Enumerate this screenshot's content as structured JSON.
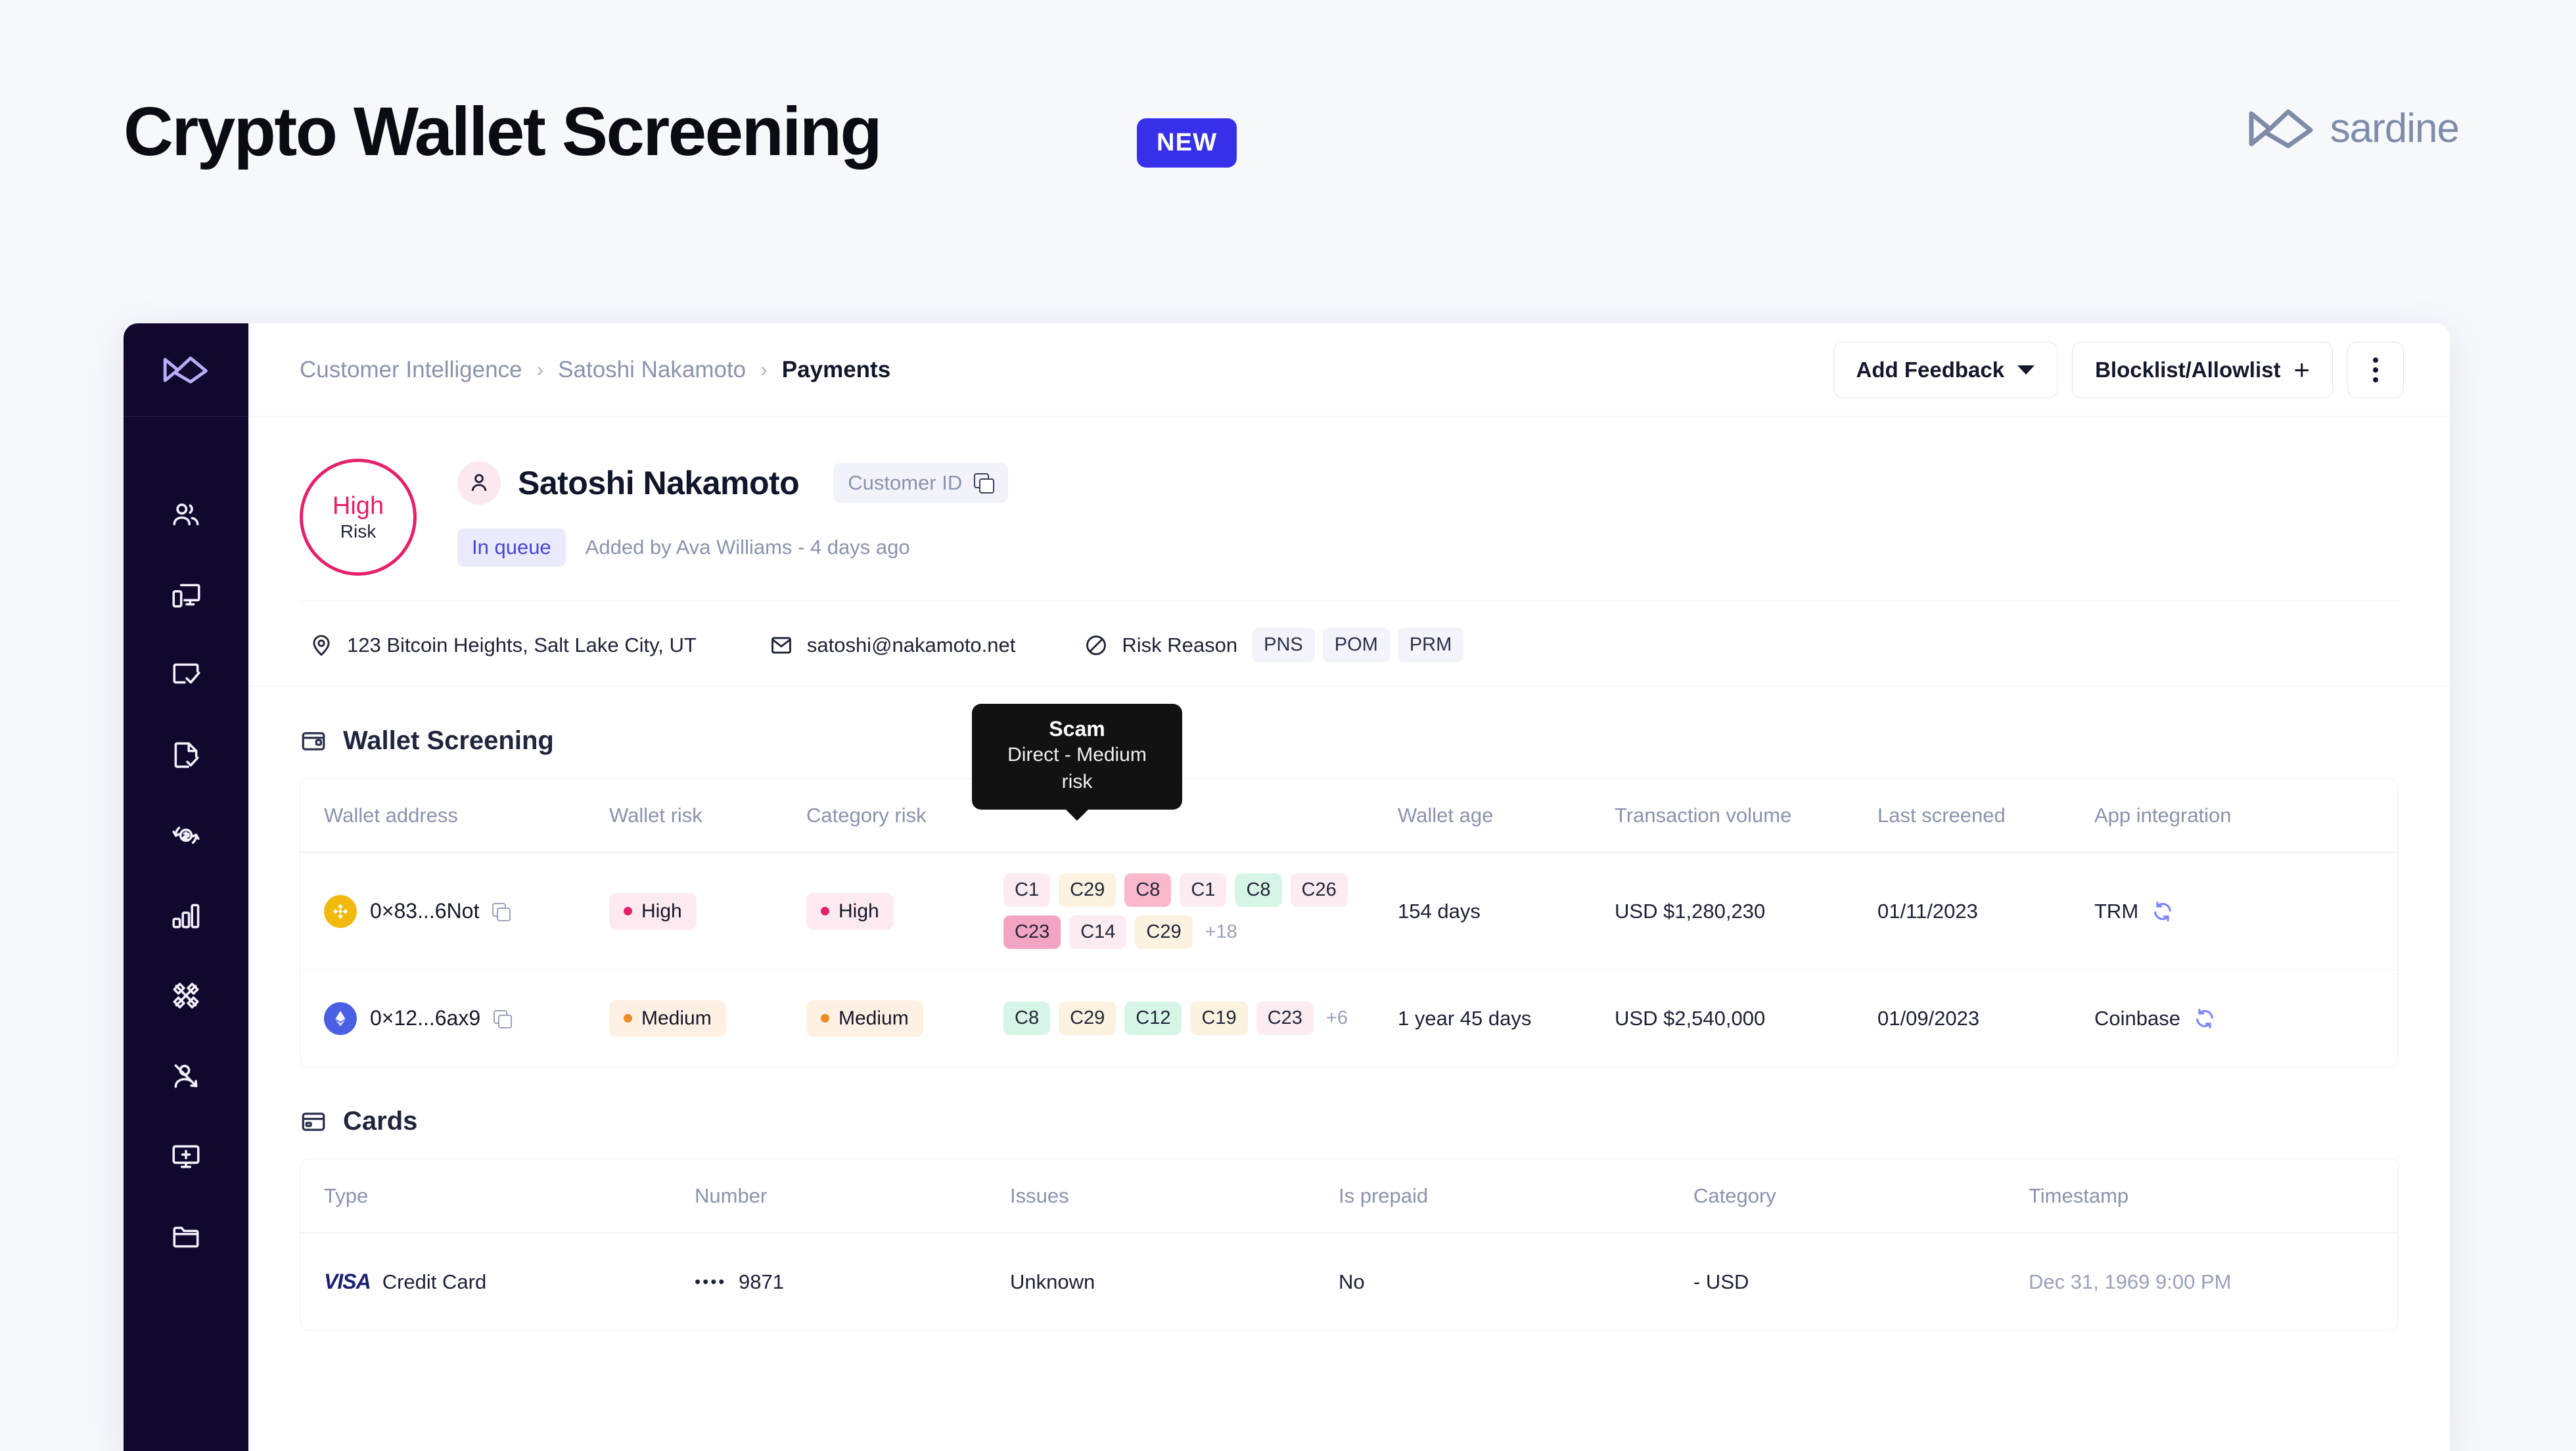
{
  "hero": {
    "title": "Crypto Wallet Screening",
    "badge": "NEW",
    "brand": "sardine"
  },
  "sidebar": {
    "items": [
      {
        "name": "users-icon"
      },
      {
        "name": "devices-icon"
      },
      {
        "name": "case-check-icon"
      },
      {
        "name": "document-check-icon"
      },
      {
        "name": "transaction-refresh-icon"
      },
      {
        "name": "bar-chart-icon"
      },
      {
        "name": "network-icon"
      },
      {
        "name": "user-blocked-icon"
      },
      {
        "name": "monitor-add-icon"
      },
      {
        "name": "folder-icon"
      }
    ]
  },
  "topbar": {
    "breadcrumb": [
      "Customer Intelligence",
      "Satoshi Nakamoto",
      "Payments"
    ],
    "separator": "›",
    "add_feedback": "Add Feedback",
    "blocklist": "Blocklist/Allowlist",
    "blocklist_plus": "+"
  },
  "profile": {
    "risk_level": "High",
    "risk_label": "Risk",
    "name": "Satoshi Nakamoto",
    "customer_id_label": "Customer ID",
    "status": "In queue",
    "added_by": "Added by Ava Williams - 4 days ago",
    "address": "123 Bitcoin Heights, Salt Lake City, UT",
    "email": "satoshi@nakamoto.net",
    "risk_reason_label": "Risk Reason",
    "risk_reason_tags": [
      "PNS",
      "POM",
      "PRM"
    ]
  },
  "wallet_section": {
    "title": "Wallet Screening",
    "columns": [
      "Wallet address",
      "Wallet risk",
      "Category risk",
      "",
      "Wallet age",
      "Transaction volume",
      "Last screened",
      "App integration"
    ],
    "tooltip": {
      "title": "Scam",
      "subtitle": "Direct - Medium risk"
    },
    "rows": [
      {
        "coin": "bnb",
        "address": "0×83...6Not",
        "wallet_risk": "High",
        "wallet_risk_level": "high",
        "category_risk": "High",
        "category_risk_level": "high",
        "categories": [
          {
            "label": "C1",
            "tone": "pinkL"
          },
          {
            "label": "C29",
            "tone": "cream"
          },
          {
            "label": "C8",
            "tone": "pinkM"
          },
          {
            "label": "C1",
            "tone": "pinkL"
          },
          {
            "label": "C8",
            "tone": "mint"
          },
          {
            "label": "C26",
            "tone": "pinkL"
          },
          {
            "label": "C23",
            "tone": "pinkD"
          },
          {
            "label": "C14",
            "tone": "pinkL"
          },
          {
            "label": "C29",
            "tone": "cream"
          }
        ],
        "more": "+18",
        "wallet_age": "154 days",
        "transaction_volume": "USD $1,280,230",
        "last_screened": "01/11/2023",
        "app_integration": "TRM"
      },
      {
        "coin": "eth",
        "address": "0×12...6ax9",
        "wallet_risk": "Medium",
        "wallet_risk_level": "medium",
        "category_risk": "Medium",
        "category_risk_level": "medium",
        "categories": [
          {
            "label": "C8",
            "tone": "mint"
          },
          {
            "label": "C29",
            "tone": "cream"
          },
          {
            "label": "C12",
            "tone": "mint"
          },
          {
            "label": "C19",
            "tone": "cream"
          },
          {
            "label": "C23",
            "tone": "pinkL"
          }
        ],
        "more": "+6",
        "wallet_age": "1 year 45 days",
        "transaction_volume": "USD $2,540,000",
        "last_screened": "01/09/2023",
        "app_integration": "Coinbase"
      }
    ]
  },
  "cards_section": {
    "title": "Cards",
    "columns": [
      "Type",
      "Number",
      "Issues",
      "Is prepaid",
      "Category",
      "Timestamp"
    ],
    "rows": [
      {
        "brand": "VISA",
        "type": "Credit Card",
        "mask": "••••",
        "number": "9871",
        "issues": "Unknown",
        "is_prepaid": "No",
        "category": "- USD",
        "timestamp_date": "Dec 31, 1969",
        "timestamp_time": "9:00 PM"
      }
    ]
  },
  "colors": {
    "accent": "#3730E8",
    "brand_gray": "#7E8CA8",
    "sidebar": "#12082E",
    "high_risk": "#E5206B",
    "medium_risk": "#F08A24",
    "page_bg": "#F7F8FC"
  }
}
